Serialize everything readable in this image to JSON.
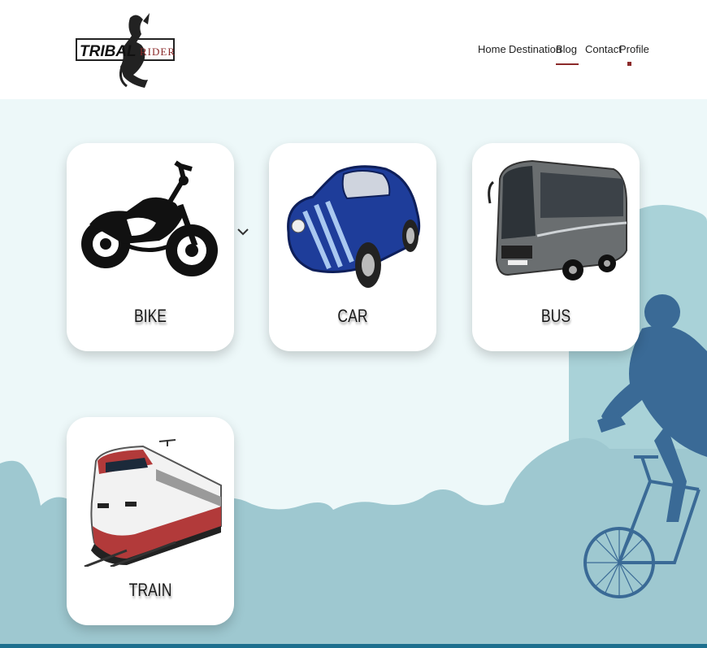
{
  "header": {
    "logo_text_left": "TRIBAL",
    "logo_text_right": "RIDER",
    "nav": [
      {
        "label": "Home"
      },
      {
        "label": "Destination"
      },
      {
        "label": "Blog"
      },
      {
        "label": "Contact"
      },
      {
        "label": "Profile"
      }
    ]
  },
  "cards": [
    {
      "label": "BIKE",
      "icon": "motorcycle-image"
    },
    {
      "label": "CAR",
      "icon": "car-image"
    },
    {
      "label": "BUS",
      "icon": "bus-image"
    },
    {
      "label": "TRAIN",
      "icon": "train-image"
    }
  ],
  "colors": {
    "accent": "#8b2a2a",
    "background": "#edf8f9",
    "hills": "#9ec8d0",
    "cyclist": "#3a6a96",
    "bottom_strip": "#1d6f8e"
  }
}
